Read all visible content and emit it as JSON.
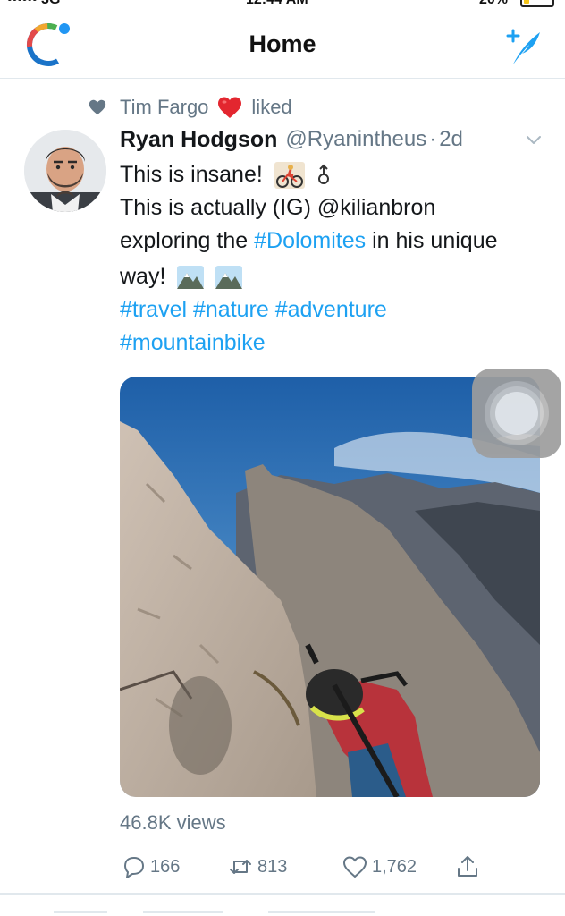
{
  "status_bar": {
    "left": "•••••• 3G",
    "time": "12:44 AM",
    "battery": "20%",
    "battery_level": 0.2
  },
  "header": {
    "title": "Home",
    "logo_icon": "app-logo-ring-icon",
    "compose_icon": "compose-tweet-icon"
  },
  "tweet": {
    "social_context": {
      "actor": "Tim Fargo",
      "action": "liked"
    },
    "author": {
      "name": "Ryan Hodgson",
      "handle": "@Ryanintheus",
      "separator": "·",
      "time": "2d"
    },
    "text": {
      "line1": "This is insane!",
      "line2": "This is actually (IG) @kilianbron",
      "line3_before": "exploring the ",
      "line3_hashtag": "#Dolomites",
      "line3_after": " in his unique",
      "line4": "way!",
      "hashtags_line1": "#travel #nature #adventure",
      "hashtags_line2": "#mountainbike"
    },
    "media": {
      "type": "video"
    },
    "views": "46.8K views",
    "actions": {
      "replies": "166",
      "retweets": "813",
      "likes": "1,762"
    }
  },
  "colors": {
    "accent": "#1da1f2",
    "secondary_text": "#657786",
    "like_red": "#e0245e",
    "divider": "#e1e8ed"
  }
}
